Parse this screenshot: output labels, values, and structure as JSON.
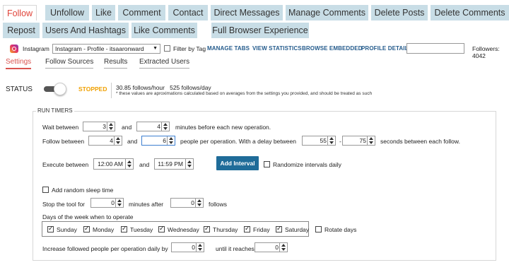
{
  "tabs": [
    {
      "label": "Follow",
      "active": true
    },
    {
      "label": "Unfollow"
    },
    {
      "label": "Like"
    },
    {
      "label": "Comment"
    },
    {
      "label": "Contact"
    },
    {
      "label": "Direct Messages"
    },
    {
      "label": "Manage Comments"
    },
    {
      "label": "Delete Posts"
    },
    {
      "label": "Delete Comments"
    },
    {
      "label": "Repost"
    },
    {
      "label": "Users And Hashtags"
    },
    {
      "label": "Like Comments"
    },
    {
      "label": "Full Browser Experience"
    }
  ],
  "account": {
    "network": "Instagram",
    "profile": "Instagram - Profile - itsaaronward",
    "filter_by_tag": "Filter by Tag",
    "links": [
      "MANAGE TABS",
      "VIEW STATISTICS",
      "BROWSE EMBEDDED",
      "PROFILE DETAILS"
    ],
    "search_value": "",
    "followers": "Followers: 4042"
  },
  "subtabs": [
    "Settings",
    "Follow Sources",
    "Results",
    "Extracted Users"
  ],
  "status": {
    "label": "STATUS",
    "state": "STOPPED",
    "follows_hour": "30.85 follows/hour",
    "follows_day": "525 follows/day",
    "note": "* these values are aproximations calculated based on averages from the settings you provided, and should be treated as such"
  },
  "timers": {
    "title": "RUN TIMERS",
    "wait_between": "Wait between",
    "wait_min": "3",
    "and1": "and",
    "wait_max": "4",
    "wait_suffix": "minutes before each new operation.",
    "follow_between": "Follow between",
    "follow_min": "4",
    "and2": "and",
    "follow_max": "6",
    "follow_mid": "people per operation. With a delay between",
    "delay_min": "55",
    "dash": "-",
    "delay_max": "75",
    "delay_suffix": "seconds between each follow.",
    "execute_between": "Execute between",
    "exec_start": "12:00 AM",
    "and3": "and",
    "exec_end": "11:59 PM",
    "add_interval": "Add Interval",
    "randomize": "Randomize intervals daily",
    "add_sleep": "Add random sleep time",
    "stop_for": "Stop the tool for",
    "stop_minutes": "0",
    "minutes_after": "minutes after",
    "stop_follows": "0",
    "follows": "follows",
    "days_title": "Days of the week when to operate",
    "days": [
      "Sunday",
      "Monday",
      "Tuesday",
      "Wednesday",
      "Thursday",
      "Friday",
      "Saturday"
    ],
    "rotate_days": "Rotate days",
    "increase_label": "Increase followed people per operation daily by",
    "increase_value": "0",
    "until_label": "until it reaches",
    "until_value": "0"
  },
  "colors": {
    "tab_bg": "#c8dde6",
    "active_tab_text": "#e0443a",
    "link": "#245b8c",
    "stopped": "#f0a000",
    "button": "#1f6c99"
  }
}
